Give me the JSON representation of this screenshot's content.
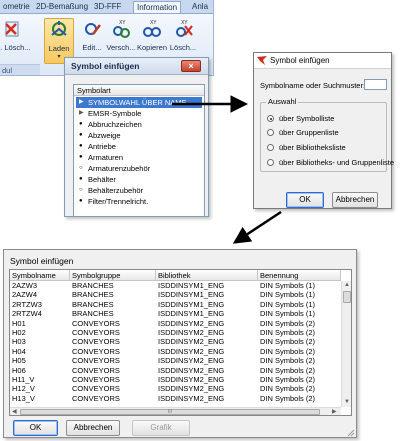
{
  "ribbon": {
    "tabs": [
      "ometrie",
      "2D-Bemaßung",
      "3D-FFF",
      "Information",
      "Anla"
    ],
    "buttons": [
      {
        "label": "g. Lösch...",
        "icon": "delete-icon"
      },
      {
        "label": "Laden",
        "icon": "load-symbol-icon"
      },
      {
        "label": "Edit...",
        "icon": "edit-symbol-icon"
      },
      {
        "label": "Versch...",
        "icon": "move-symbol-icon"
      },
      {
        "label": "Kopieren",
        "icon": "copy-symbol-icon"
      },
      {
        "label": "Lösch...",
        "icon": "delete-symbol-icon"
      }
    ],
    "group_label": "dul"
  },
  "panel": {
    "title": "Symbol einfügen",
    "close": "×",
    "list_header": "Symbolart",
    "items": [
      {
        "text": "SYMBOLWAHL ÜBER NAME",
        "mark": "▶",
        "selected": true
      },
      {
        "text": "EMSR-Symbole",
        "mark": "▶",
        "selected": false
      },
      {
        "text": "Abbruchzeichen",
        "mark": "●",
        "selected": false
      },
      {
        "text": "Abzweige",
        "mark": "●",
        "selected": false
      },
      {
        "text": "Antriebe",
        "mark": "●",
        "selected": false
      },
      {
        "text": "Armaturen",
        "mark": "●",
        "selected": false
      },
      {
        "text": "Armaturenzubehör",
        "mark": "○",
        "selected": false
      },
      {
        "text": "Behälter",
        "mark": "●",
        "selected": false
      },
      {
        "text": "Behälterzubehör",
        "mark": "○",
        "selected": false
      },
      {
        "text": "Filter/Trennelricht.",
        "mark": "●",
        "selected": false
      }
    ]
  },
  "small_dialog": {
    "title": "Symbol einfügen",
    "search_label": "Symbolname oder Suchmuster:",
    "search_value": "",
    "group_label": "Auswahl",
    "options": [
      {
        "label": "über Symbolliste",
        "checked": true
      },
      {
        "label": "über Gruppenliste",
        "checked": false
      },
      {
        "label": "über Bibliotheksliste",
        "checked": false
      },
      {
        "label": "über Bibliotheks- und Gruppenliste",
        "checked": false
      }
    ],
    "ok": "OK",
    "cancel": "Abbrechen"
  },
  "big_dialog": {
    "title": "Symbol einfügen",
    "columns": [
      "Symbolname",
      "Symbolgruppe",
      "Bibliothek",
      "Benennung"
    ],
    "rows": [
      [
        "2AZW3",
        "BRANCHES",
        "ISDDINSYM1_ENG",
        "DIN Symbols (1)"
      ],
      [
        "2AZW4",
        "BRANCHES",
        "ISDDINSYM1_ENG",
        "DIN Symbols (1)"
      ],
      [
        "2RTZW3",
        "BRANCHES",
        "ISDDINSYM1_ENG",
        "DIN Symbols (1)"
      ],
      [
        "2RTZW4",
        "BRANCHES",
        "ISDDINSYM1_ENG",
        "DIN Symbols (1)"
      ],
      [
        "H01",
        "CONVEYORS",
        "ISDDINSYM2_ENG",
        "DIN Symbols (2)"
      ],
      [
        "H02",
        "CONVEYORS",
        "ISDDINSYM2_ENG",
        "DIN Symbols (2)"
      ],
      [
        "H03",
        "CONVEYORS",
        "ISDDINSYM2_ENG",
        "DIN Symbols (2)"
      ],
      [
        "H04",
        "CONVEYORS",
        "ISDDINSYM2_ENG",
        "DIN Symbols (2)"
      ],
      [
        "H05",
        "CONVEYORS",
        "ISDDINSYM2_ENG",
        "DIN Symbols (2)"
      ],
      [
        "H06",
        "CONVEYORS",
        "ISDDINSYM2_ENG",
        "DIN Symbols (2)"
      ],
      [
        "H11_V",
        "CONVEYORS",
        "ISDDINSYM2_ENG",
        "DIN Symbols (2)"
      ],
      [
        "H12_V",
        "CONVEYORS",
        "ISDDINSYM2_ENG",
        "DIN Symbols (2)"
      ],
      [
        "H13_V",
        "CONVEYORS",
        "ISDDINSYM2_ENG",
        "DIN Symbols (2)"
      ]
    ],
    "scroll_mark": "III",
    "ok": "OK",
    "cancel": "Abbrechen",
    "graphic": "Grafik"
  }
}
